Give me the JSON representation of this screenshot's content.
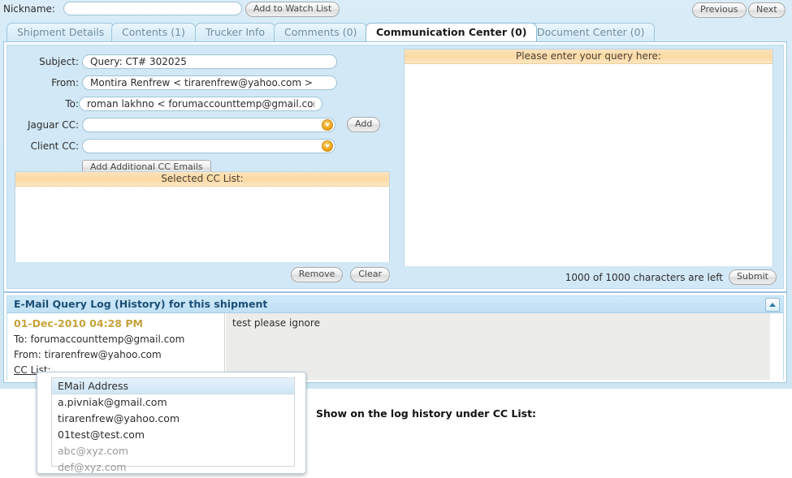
{
  "topbar": {
    "nickname_label": "Nickname:",
    "nickname_value": "",
    "nickname_placeholder": "",
    "add_to_watch_list": "Add to Watch List",
    "previous": "Previous",
    "next": "Next"
  },
  "tabs": [
    {
      "label": "Shipment Details",
      "active": false
    },
    {
      "label": "Contents (1)",
      "active": false
    },
    {
      "label": "Trucker Info",
      "active": false
    },
    {
      "label": "Comments (0)",
      "active": false
    },
    {
      "label": "Communication Center (0)",
      "active": true
    },
    {
      "label": "Document Center (0)",
      "active": false
    }
  ],
  "form": {
    "subject_label": "Subject:",
    "subject_value": "Query: CT# 302025",
    "from_label": "From:",
    "from_value": "Montira Renfrew < tirarenfrew@yahoo.com >",
    "to_label": "To:",
    "to_value": "roman lakhno < forumaccounttemp@gmail.com >",
    "jaguar_cc_label": "Jaguar CC:",
    "jaguar_cc_value": "",
    "client_cc_label": "Client CC:",
    "client_cc_value": "",
    "add_button": "Add",
    "add_additional_cc_button": "Add Additional CC Emails",
    "selected_cc_list_header": "Selected CC List:",
    "selected_cc_items": [],
    "remove_button": "Remove",
    "clear_button": "Clear"
  },
  "query": {
    "header": "Please enter your query here:",
    "value": "",
    "placeholder": "",
    "char_count": "1000 of 1000 characters are left",
    "submit_button": "Submit"
  },
  "log": {
    "title": "E-Mail Query Log (History) for this shipment",
    "collapse_icon": "chevron-up-icon",
    "entries": [
      {
        "date": "01-Dec-2010 04:28 PM",
        "to": "To: forumaccounttemp@gmail.com",
        "from": "From: tirarenfrew@yahoo.com",
        "cc_list_link": "CC List:",
        "message": "test please ignore"
      }
    ]
  },
  "popup": {
    "header": "EMail Address",
    "rows": [
      {
        "email": "a.pivniak@gmail.com",
        "muted": false
      },
      {
        "email": "tirarenfrew@yahoo.com",
        "muted": false
      },
      {
        "email": "01test@test.com",
        "muted": false
      },
      {
        "email": "abc@xyz.com",
        "muted": true
      },
      {
        "email": "def@xyz.com",
        "muted": true
      }
    ]
  },
  "annotation": {
    "text": "Show on the log history under CC List:"
  },
  "colors": {
    "app_background": "#d4eaf6",
    "panel_header_orange": "#fbd9a3",
    "log_title_blue": "#1c4f77",
    "log_date_gold": "#c5a33b",
    "combo_arrow_orange": "#f0a821",
    "tab_inactive_text": "#6f8ea2"
  }
}
